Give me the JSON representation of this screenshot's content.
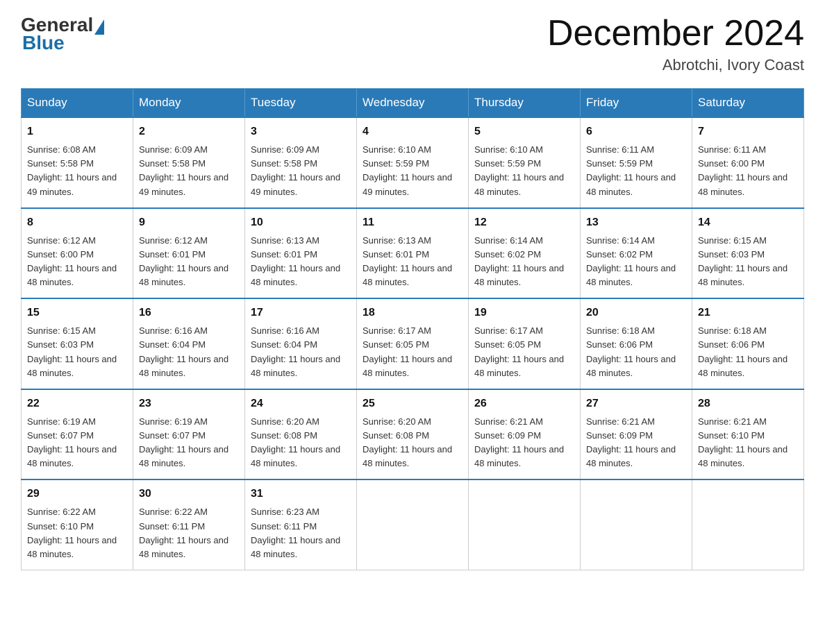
{
  "logo": {
    "general": "General",
    "blue": "Blue"
  },
  "header": {
    "month_year": "December 2024",
    "location": "Abrotchi, Ivory Coast"
  },
  "weekdays": [
    "Sunday",
    "Monday",
    "Tuesday",
    "Wednesday",
    "Thursday",
    "Friday",
    "Saturday"
  ],
  "weeks": [
    [
      {
        "day": "1",
        "sunrise": "6:08 AM",
        "sunset": "5:58 PM",
        "daylight": "11 hours and 49 minutes."
      },
      {
        "day": "2",
        "sunrise": "6:09 AM",
        "sunset": "5:58 PM",
        "daylight": "11 hours and 49 minutes."
      },
      {
        "day": "3",
        "sunrise": "6:09 AM",
        "sunset": "5:58 PM",
        "daylight": "11 hours and 49 minutes."
      },
      {
        "day": "4",
        "sunrise": "6:10 AM",
        "sunset": "5:59 PM",
        "daylight": "11 hours and 49 minutes."
      },
      {
        "day": "5",
        "sunrise": "6:10 AM",
        "sunset": "5:59 PM",
        "daylight": "11 hours and 48 minutes."
      },
      {
        "day": "6",
        "sunrise": "6:11 AM",
        "sunset": "5:59 PM",
        "daylight": "11 hours and 48 minutes."
      },
      {
        "day": "7",
        "sunrise": "6:11 AM",
        "sunset": "6:00 PM",
        "daylight": "11 hours and 48 minutes."
      }
    ],
    [
      {
        "day": "8",
        "sunrise": "6:12 AM",
        "sunset": "6:00 PM",
        "daylight": "11 hours and 48 minutes."
      },
      {
        "day": "9",
        "sunrise": "6:12 AM",
        "sunset": "6:01 PM",
        "daylight": "11 hours and 48 minutes."
      },
      {
        "day": "10",
        "sunrise": "6:13 AM",
        "sunset": "6:01 PM",
        "daylight": "11 hours and 48 minutes."
      },
      {
        "day": "11",
        "sunrise": "6:13 AM",
        "sunset": "6:01 PM",
        "daylight": "11 hours and 48 minutes."
      },
      {
        "day": "12",
        "sunrise": "6:14 AM",
        "sunset": "6:02 PM",
        "daylight": "11 hours and 48 minutes."
      },
      {
        "day": "13",
        "sunrise": "6:14 AM",
        "sunset": "6:02 PM",
        "daylight": "11 hours and 48 minutes."
      },
      {
        "day": "14",
        "sunrise": "6:15 AM",
        "sunset": "6:03 PM",
        "daylight": "11 hours and 48 minutes."
      }
    ],
    [
      {
        "day": "15",
        "sunrise": "6:15 AM",
        "sunset": "6:03 PM",
        "daylight": "11 hours and 48 minutes."
      },
      {
        "day": "16",
        "sunrise": "6:16 AM",
        "sunset": "6:04 PM",
        "daylight": "11 hours and 48 minutes."
      },
      {
        "day": "17",
        "sunrise": "6:16 AM",
        "sunset": "6:04 PM",
        "daylight": "11 hours and 48 minutes."
      },
      {
        "day": "18",
        "sunrise": "6:17 AM",
        "sunset": "6:05 PM",
        "daylight": "11 hours and 48 minutes."
      },
      {
        "day": "19",
        "sunrise": "6:17 AM",
        "sunset": "6:05 PM",
        "daylight": "11 hours and 48 minutes."
      },
      {
        "day": "20",
        "sunrise": "6:18 AM",
        "sunset": "6:06 PM",
        "daylight": "11 hours and 48 minutes."
      },
      {
        "day": "21",
        "sunrise": "6:18 AM",
        "sunset": "6:06 PM",
        "daylight": "11 hours and 48 minutes."
      }
    ],
    [
      {
        "day": "22",
        "sunrise": "6:19 AM",
        "sunset": "6:07 PM",
        "daylight": "11 hours and 48 minutes."
      },
      {
        "day": "23",
        "sunrise": "6:19 AM",
        "sunset": "6:07 PM",
        "daylight": "11 hours and 48 minutes."
      },
      {
        "day": "24",
        "sunrise": "6:20 AM",
        "sunset": "6:08 PM",
        "daylight": "11 hours and 48 minutes."
      },
      {
        "day": "25",
        "sunrise": "6:20 AM",
        "sunset": "6:08 PM",
        "daylight": "11 hours and 48 minutes."
      },
      {
        "day": "26",
        "sunrise": "6:21 AM",
        "sunset": "6:09 PM",
        "daylight": "11 hours and 48 minutes."
      },
      {
        "day": "27",
        "sunrise": "6:21 AM",
        "sunset": "6:09 PM",
        "daylight": "11 hours and 48 minutes."
      },
      {
        "day": "28",
        "sunrise": "6:21 AM",
        "sunset": "6:10 PM",
        "daylight": "11 hours and 48 minutes."
      }
    ],
    [
      {
        "day": "29",
        "sunrise": "6:22 AM",
        "sunset": "6:10 PM",
        "daylight": "11 hours and 48 minutes."
      },
      {
        "day": "30",
        "sunrise": "6:22 AM",
        "sunset": "6:11 PM",
        "daylight": "11 hours and 48 minutes."
      },
      {
        "day": "31",
        "sunrise": "6:23 AM",
        "sunset": "6:11 PM",
        "daylight": "11 hours and 48 minutes."
      },
      null,
      null,
      null,
      null
    ]
  ]
}
